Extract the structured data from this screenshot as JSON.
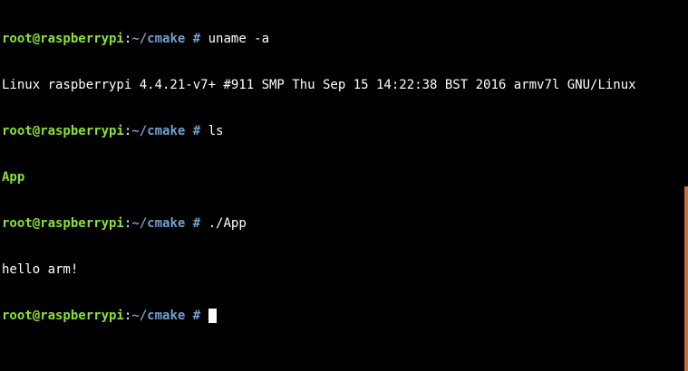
{
  "terminal": {
    "lines": [
      {
        "host": "root@raspberrypi",
        "sep": ":",
        "path": "~/cmake",
        "prompt": " # ",
        "command": "uname -a"
      },
      {
        "output": "Linux raspberrypi 4.4.21-v7+ #911 SMP Thu Sep 15 14:22:38 BST 2016 armv7l GNU/Linux"
      },
      {
        "host": "root@raspberrypi",
        "sep": ":",
        "path": "~/cmake",
        "prompt": " # ",
        "command": "ls"
      },
      {
        "file": "App"
      },
      {
        "host": "root@raspberrypi",
        "sep": ":",
        "path": "~/cmake",
        "prompt": " # ",
        "command": "./App"
      },
      {
        "output": "hello arm!"
      },
      {
        "host": "root@raspberrypi",
        "sep": ":",
        "path": "~/cmake",
        "prompt": " # ",
        "command": ""
      }
    ]
  },
  "colors": {
    "background": "#000000",
    "host": "#8ae234",
    "path": "#729fcf",
    "text": "#ffffff",
    "scrollbar": "#c86a45"
  }
}
